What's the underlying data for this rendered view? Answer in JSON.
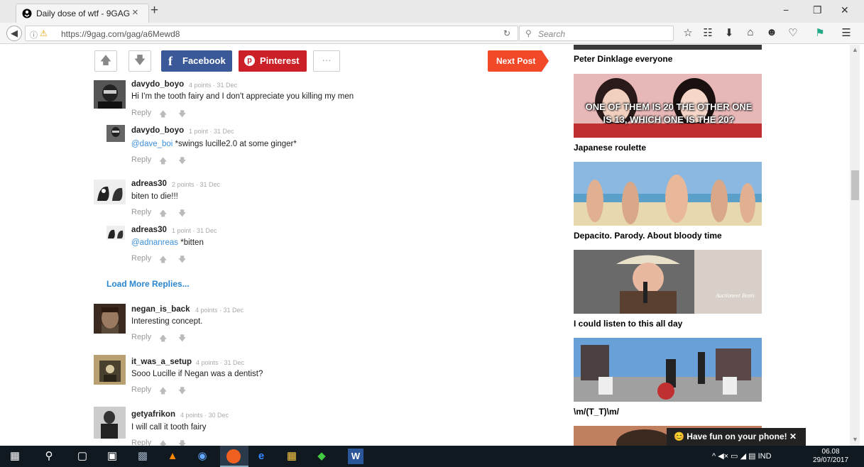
{
  "browser": {
    "tab_title": "Daily dose of wtf - 9GAG",
    "url": "https://9gag.com/gag/a6Mewd8",
    "search_placeholder": "Search",
    "tab_close": "×",
    "new_tab": "+",
    "win_min": "−",
    "win_restore": "❐",
    "win_close": "✕"
  },
  "toolbar": {
    "facebook_label": "Facebook",
    "pinterest_label": "Pinterest",
    "more_label": "···",
    "next_post_label": "Next Post"
  },
  "comments": [
    {
      "user": "davydo_boyo",
      "meta": "4 points · 31 Dec",
      "mention": "",
      "text": "Hi I'm the tooth fairy and I don't appreciate you killing my men",
      "reply": "Reply"
    },
    {
      "user": "davydo_boyo",
      "meta": "1 point · 31 Dec",
      "mention": "@dave_boi",
      "text": " *swings lucille2.0 at some ginger*",
      "reply": "Reply"
    },
    {
      "user": "adreas30",
      "meta": "2 points · 31 Dec",
      "mention": "",
      "text": "biten to die!!!",
      "reply": "Reply"
    },
    {
      "user": "adreas30",
      "meta": "1 point · 31 Dec",
      "mention": "@adnanreas",
      "text": " *bitten",
      "reply": "Reply"
    },
    {
      "user": "negan_is_back",
      "meta": "4 points · 31 Dec",
      "mention": "",
      "text": "Interesting concept.",
      "reply": "Reply"
    },
    {
      "user": "it_was_a_setup",
      "meta": "4 points · 31 Dec",
      "mention": "",
      "text": "Sooo Lucille if Negan was a dentist?",
      "reply": "Reply"
    },
    {
      "user": "getyafrikon",
      "meta": "4 points · 30 Dec",
      "mention": "",
      "text": "I will call it tooth fairy",
      "reply": "Reply"
    }
  ],
  "load_more": "Load More Replies...",
  "sidebar": {
    "items": [
      {
        "title": "Peter Dinklage everyone"
      },
      {
        "title": "Japanese roulette",
        "caption": "ONE OF THEM IS 20 THE OTHER ONE IS 13, WHICH ONE IS THE 20?"
      },
      {
        "title": "Depacito. Parody. About bloody time"
      },
      {
        "title": "I could listen to this all day",
        "caption": "Auctioneer Beats"
      },
      {
        "title": "\\m/(T_T)\\m/"
      }
    ]
  },
  "toast": "😊 Have fun on your phone! ✕",
  "taskbar": {
    "lang": "IND",
    "time": "06.08",
    "date": "29/07/2017"
  }
}
